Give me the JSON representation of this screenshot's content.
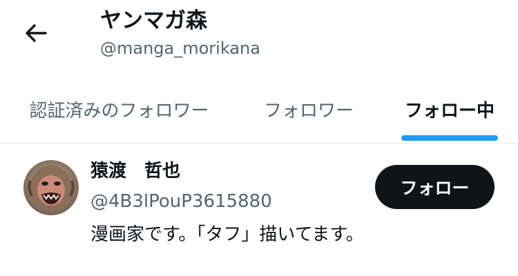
{
  "header": {
    "back_icon": "arrow-left-icon",
    "title": "ヤンマガ森",
    "handle": "@manga_morikana"
  },
  "tabs": [
    {
      "label": "認証済みのフォロワー",
      "active": false
    },
    {
      "label": "フォロワー",
      "active": false
    },
    {
      "label": "フォロー中",
      "active": true
    }
  ],
  "accent_color": "#1d9bf0",
  "users": [
    {
      "name": "猿渡　哲也",
      "handle": "@4B3lPouP3615880",
      "bio": "漫画家です。「タフ」描いてます。",
      "button_label": "フォロー"
    }
  ]
}
